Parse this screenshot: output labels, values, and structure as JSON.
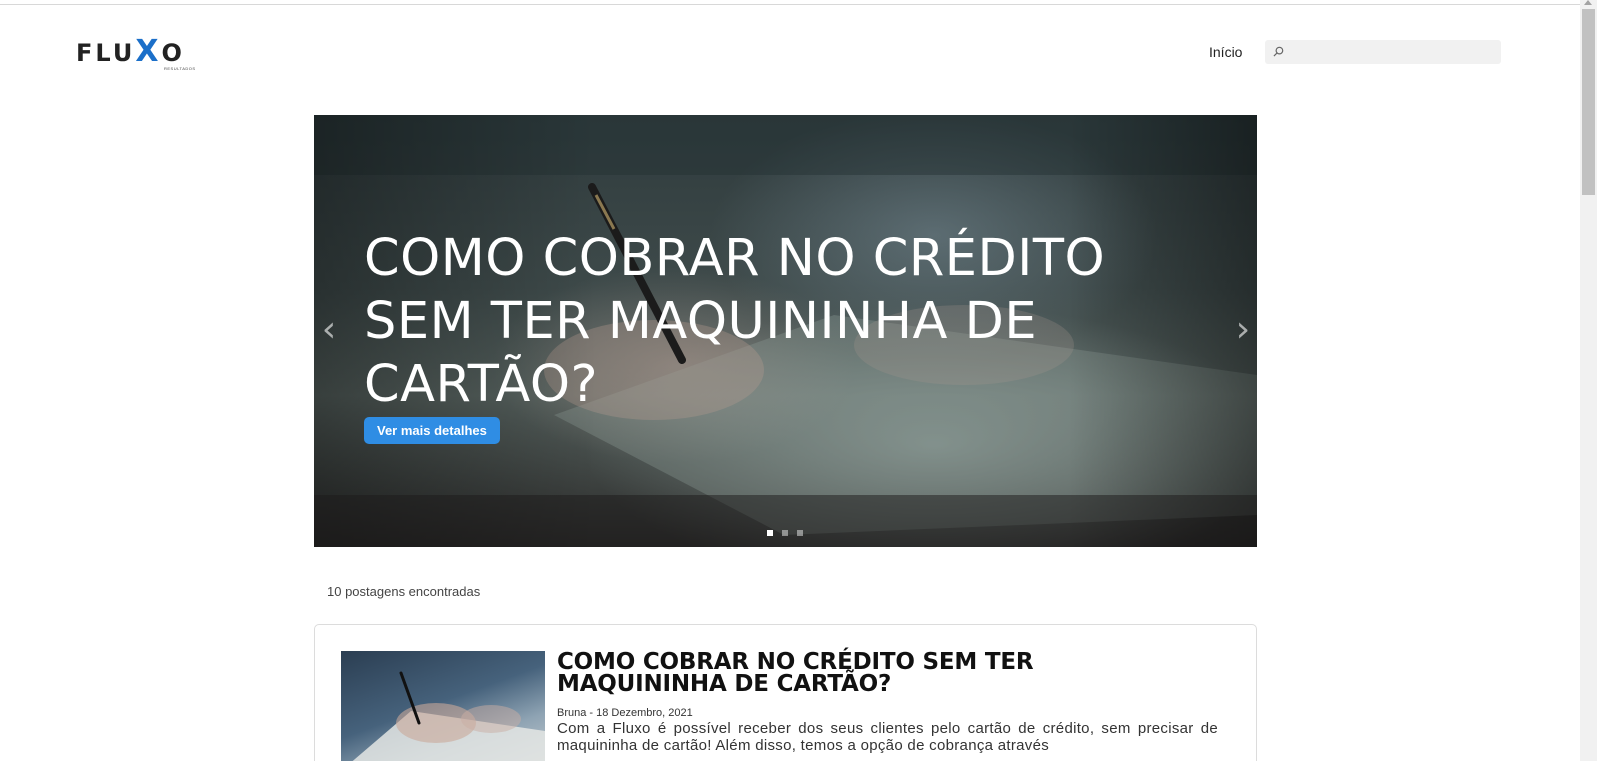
{
  "header": {
    "logo_text_left": "FLU",
    "logo_text_x": "X",
    "logo_text_right": "O",
    "logo_subtext": "RESULTADOS",
    "nav_home": "Início",
    "search_placeholder": "",
    "search_icon": "search-icon"
  },
  "hero": {
    "title": "COMO COBRAR NO CRÉDITO SEM TER MAQUININHA DE CARTÃO?",
    "button_label": "Ver mais detalhes",
    "prev_arrow": "‹",
    "next_arrow": "›",
    "slide_count": 3,
    "active_slide": 1
  },
  "results": {
    "count_text": "10 postagens encontradas"
  },
  "posts": [
    {
      "title": "COMO COBRAR NO CRÉDITO SEM TER MAQUININHA DE CARTÃO?",
      "meta": "Bruna - 18 Dezembro, 2021",
      "excerpt": "Com a Fluxo é possível receber dos seus clientes pelo cartão de crédito, sem precisar de maquininha de cartão! Além disso, temos a opção de cobrança através"
    }
  ],
  "colors": {
    "accent": "#2f8de4",
    "logo_x": "#1b6fc9"
  }
}
